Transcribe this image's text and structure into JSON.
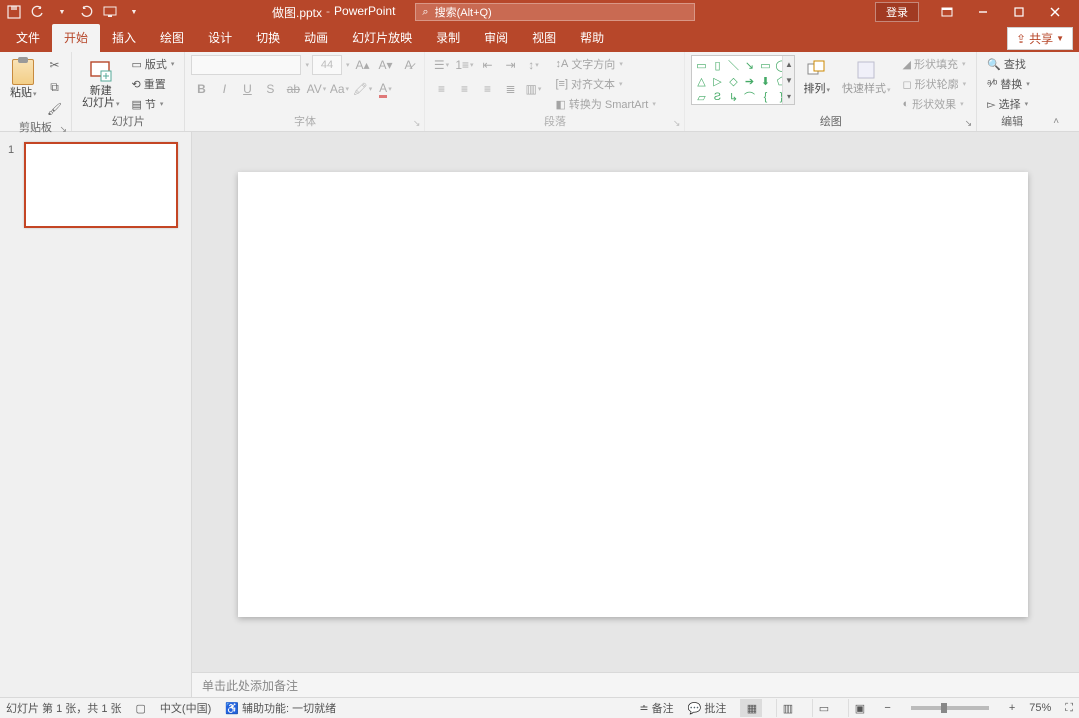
{
  "titlebar": {
    "filename": "做图.pptx",
    "sep": "-",
    "app": "PowerPoint",
    "search_placeholder": "搜索(Alt+Q)",
    "login": "登录"
  },
  "tabs": {
    "file": "文件",
    "home": "开始",
    "insert": "插入",
    "draw": "绘图",
    "design": "设计",
    "transitions": "切换",
    "animations": "动画",
    "slideshow": "幻灯片放映",
    "record": "录制",
    "review": "审阅",
    "view": "视图",
    "help": "帮助",
    "share": "共享"
  },
  "ribbon": {
    "clipboard": {
      "label": "剪贴板",
      "paste": "粘贴"
    },
    "slides": {
      "label": "幻灯片",
      "new_slide_l1": "新建",
      "new_slide_l2": "幻灯片",
      "layout": "版式",
      "reset": "重置",
      "section": "节"
    },
    "font": {
      "label": "字体",
      "size": "44"
    },
    "paragraph": {
      "label": "段落",
      "text_direction": "文字方向",
      "align_text": "对齐文本",
      "smartart": "转换为 SmartArt"
    },
    "drawing": {
      "label": "绘图",
      "arrange": "排列",
      "quick_styles": "快速样式",
      "shape_fill": "形状填充",
      "shape_outline": "形状轮廓",
      "shape_effects": "形状效果"
    },
    "editing": {
      "label": "编辑",
      "find": "查找",
      "replace": "替换",
      "select": "选择"
    }
  },
  "thumbs": {
    "slide1_num": "1"
  },
  "notes": {
    "placeholder": "单击此处添加备注"
  },
  "status": {
    "slide_info": "幻灯片 第 1 张，共 1 张",
    "lang": "中文(中国)",
    "accessibility": "辅助功能: 一切就绪",
    "notes_btn": "备注",
    "comments_btn": "批注",
    "zoom": "75%"
  }
}
